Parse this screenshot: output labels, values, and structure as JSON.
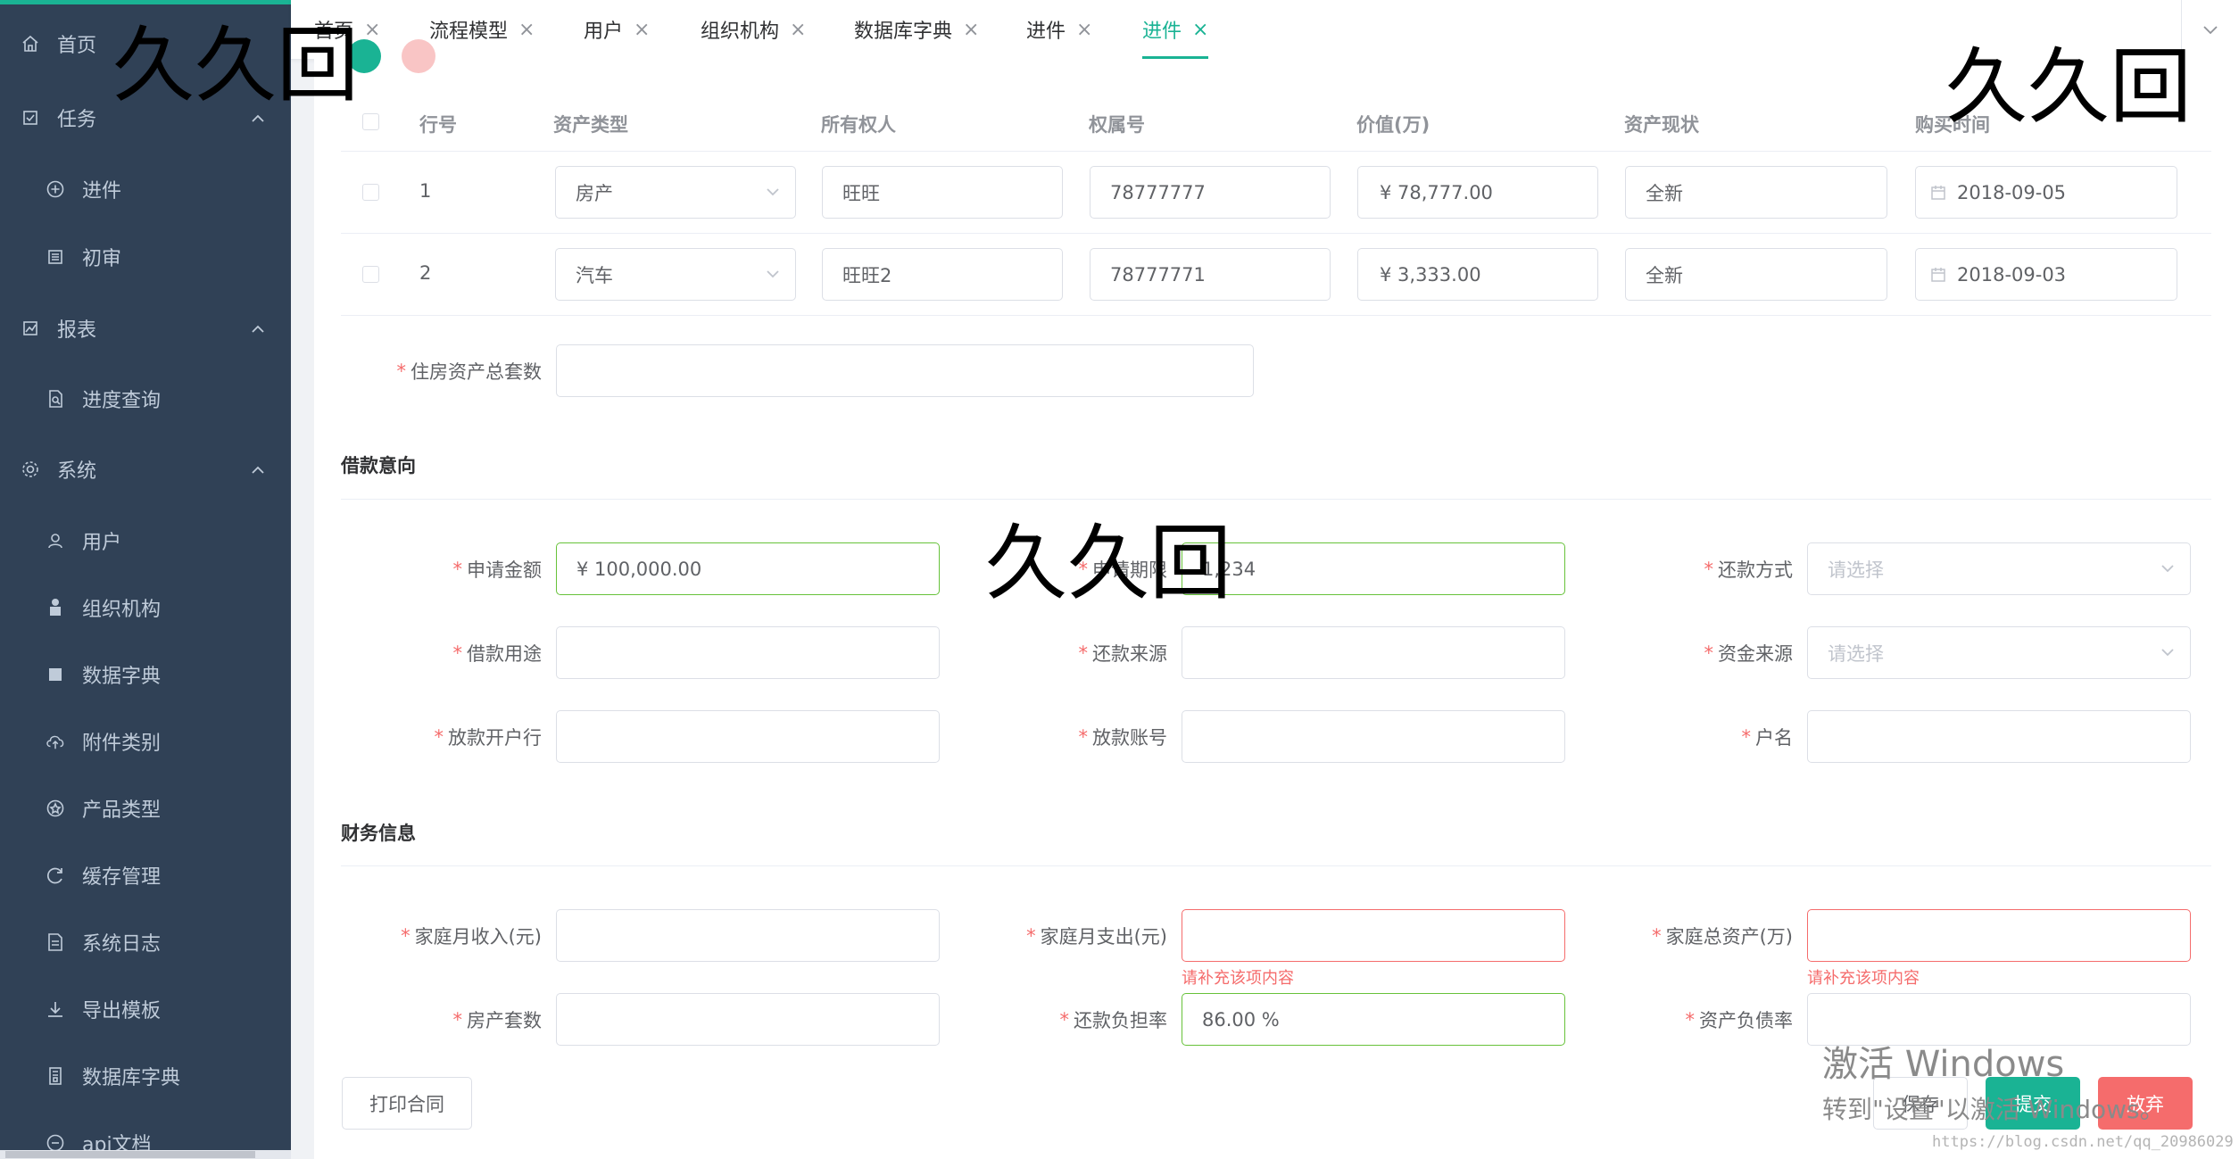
{
  "sidebar": {
    "items": [
      {
        "label": "首页",
        "icon": "home-icon"
      },
      {
        "label": "任务",
        "icon": "task-icon",
        "arrow": "chevron-up-icon"
      },
      {
        "label": "进件",
        "icon": "plus-circle-icon"
      },
      {
        "label": "初审",
        "icon": "list-icon"
      },
      {
        "label": "报表",
        "icon": "chart-icon",
        "arrow": "chevron-up-icon"
      },
      {
        "label": "进度查询",
        "icon": "doc-search-icon"
      },
      {
        "label": "系统",
        "icon": "gear-icon",
        "arrow": "chevron-up-icon"
      },
      {
        "label": "用户",
        "icon": "user-icon"
      },
      {
        "label": "组织机构",
        "icon": "org-icon"
      },
      {
        "label": "数据字典",
        "icon": "table-icon"
      },
      {
        "label": "附件类别",
        "icon": "cloud-upload-icon"
      },
      {
        "label": "产品类型",
        "icon": "star-circle-icon"
      },
      {
        "label": "缓存管理",
        "icon": "refresh-icon"
      },
      {
        "label": "系统日志",
        "icon": "log-icon"
      },
      {
        "label": "导出模板",
        "icon": "download-icon"
      },
      {
        "label": "数据库字典",
        "icon": "database-icon"
      },
      {
        "label": "api文档",
        "icon": "api-icon"
      }
    ]
  },
  "tabs": [
    {
      "label": "首页",
      "close": "×"
    },
    {
      "label": "流程模型",
      "close": "×"
    },
    {
      "label": "用户",
      "close": "×"
    },
    {
      "label": "组织机构",
      "close": "×"
    },
    {
      "label": "数据库字典",
      "close": "×"
    },
    {
      "label": "进件",
      "close": "×"
    },
    {
      "label": "进件",
      "close": "×",
      "active": true
    }
  ],
  "assets": {
    "headers": [
      "行号",
      "资产类型",
      "所有权人",
      "权属号",
      "价值(万)",
      "资产现状",
      "购买时间"
    ],
    "rows": [
      {
        "no": "1",
        "type": "房产",
        "owner": "旺旺",
        "ownership": "78777777",
        "value": "¥ 78,777.00",
        "status": "全新",
        "date": "2018-09-05"
      },
      {
        "no": "2",
        "type": "汽车",
        "owner": "旺旺2",
        "ownership": "78777771",
        "value": "¥ 3,333.00",
        "status": "全新",
        "date": "2018-09-03"
      }
    ],
    "housing_total_label": "住房资产总套数"
  },
  "loan": {
    "title": "借款意向",
    "amount_label": "申请金额",
    "amount_value": "¥ 100,000.00",
    "term_label": "申请期限",
    "term_value": "1,234",
    "repay_method_label": "还款方式",
    "repay_method_placeholder": "请选择",
    "purpose_label": "借款用途",
    "repay_source_label": "还款来源",
    "fund_source_label": "资金来源",
    "fund_source_placeholder": "请选择",
    "bank_label": "放款开户行",
    "account_label": "放款账号",
    "holder_label": "户名"
  },
  "finance": {
    "title": "财务信息",
    "income_label": "家庭月收入(元)",
    "expense_label": "家庭月支出(元)",
    "assets_label": "家庭总资产(万)",
    "error_msg": "请补充该项内容",
    "house_count_label": "房产套数",
    "burden_label": "还款负担率",
    "burden_value": "86.00 %",
    "debt_ratio_label": "资产负债率"
  },
  "buttons": {
    "print": "打印合同",
    "save": "保存",
    "submit": "提交",
    "discard": "放弃"
  },
  "overlays": {
    "watermark": "久久回",
    "windows_line1": "激活 Windows",
    "windows_line2": "转到\"设置\"以激活 Windows。",
    "csdn": "https://blog.csdn.net/qq_20986029"
  },
  "colors": {
    "accent": "#1ab394",
    "sidebar": "#304156",
    "error": "#f56c6c",
    "success": "#67c23a"
  }
}
